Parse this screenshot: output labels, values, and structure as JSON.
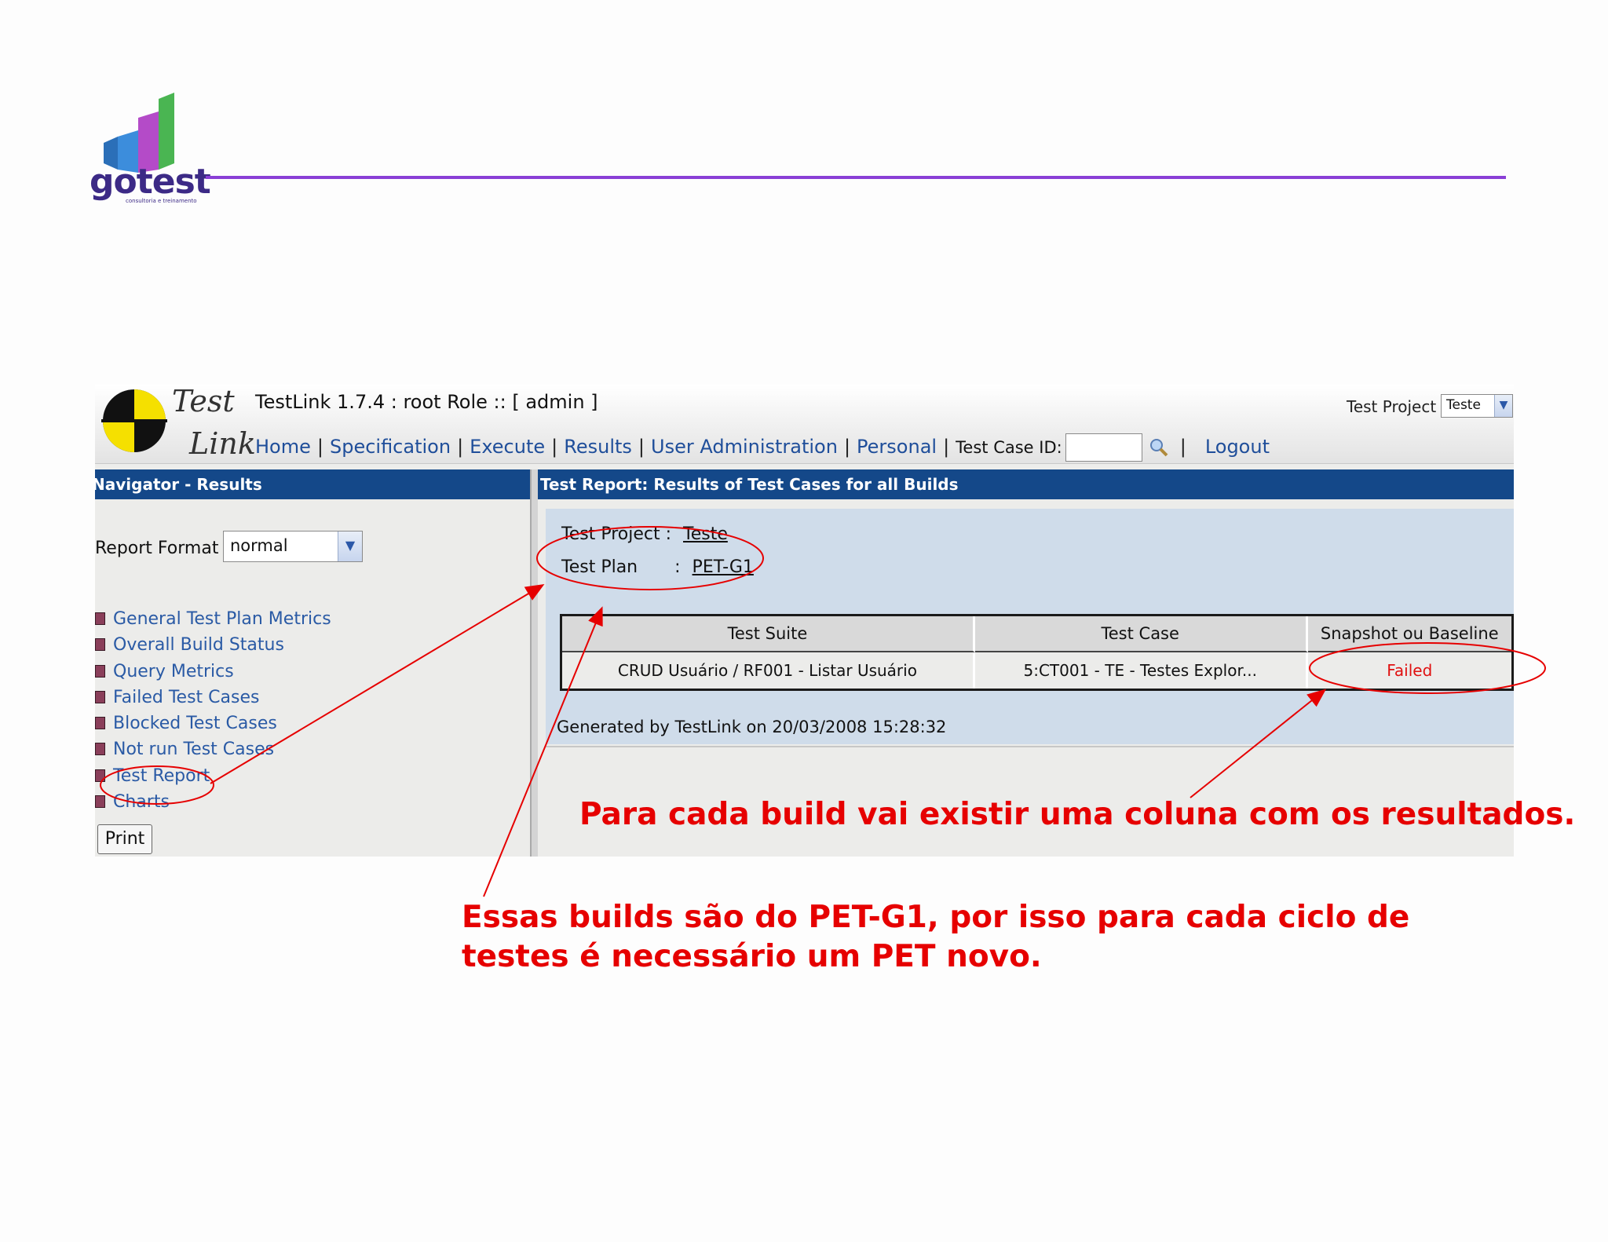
{
  "slide": {
    "logo_text": "gotest",
    "logo_subtitle": "consultoria e treinamento",
    "accent_color": "#8a3fd6"
  },
  "app": {
    "brand_top": "Test",
    "brand_bottom": "Link",
    "title": "TestLink 1.7.4 : root Role :: [ admin ]",
    "nav": {
      "home": "Home",
      "specification": "Specification",
      "execute": "Execute",
      "results": "Results",
      "user_admin": "User Administration",
      "personal": "Personal",
      "test_case_id_label": "Test Case ID:",
      "test_case_id_value": "",
      "logout": "Logout",
      "separator": "|"
    },
    "test_project": {
      "label": "Test Project",
      "selected": "Teste"
    },
    "header_color": "#144889"
  },
  "navigator": {
    "title": "Navigator - Results",
    "report_format_label": "Report Format",
    "report_format_value": "normal",
    "items": [
      {
        "label": "General Test Plan Metrics"
      },
      {
        "label": "Overall Build Status"
      },
      {
        "label": "Query Metrics"
      },
      {
        "label": "Failed Test Cases"
      },
      {
        "label": "Blocked Test Cases"
      },
      {
        "label": "Not run Test Cases"
      },
      {
        "label": "Test Report"
      },
      {
        "label": "Charts"
      }
    ],
    "print_label": "Print"
  },
  "report": {
    "title": "Test Report: Results of Test Cases for all Builds",
    "test_project_label": "Test Project :",
    "test_project_value": "Teste",
    "test_plan_label": "Test Plan",
    "test_plan_colon": ":",
    "test_plan_value": "PET-G1",
    "columns": [
      "Test Suite",
      "Test Case",
      "Snapshot ou Baseline"
    ],
    "rows": [
      {
        "suite": "CRUD Usuário / RF001 - Listar Usuário",
        "case": "5:CT001 - TE - Testes Explor...",
        "status": "Failed"
      }
    ],
    "status_color": "#e01010",
    "generated": "Generated by TestLink on 20/03/2008 15:28:32"
  },
  "annotations": {
    "note1": "Para cada build vai existir uma coluna com os resultados.",
    "note2_line1": "Essas builds são do PET-G1, por isso para cada ciclo de",
    "note2_line2": "testes é necessário um PET novo.",
    "color": "#e60000"
  }
}
